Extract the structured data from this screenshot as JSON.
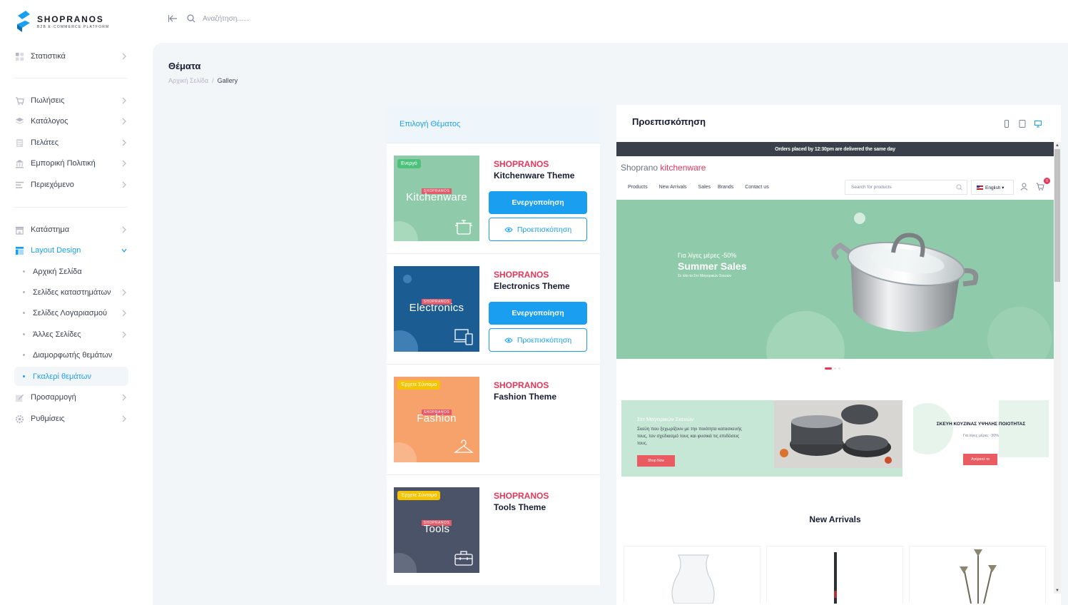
{
  "brand": {
    "name": "SHOPRANOS",
    "tagline": "B2B E-COMMERCE PLATFORM"
  },
  "topbar": {
    "search_placeholder": "Αναζήτηση......"
  },
  "sidebar": {
    "items": [
      {
        "label": "Στατιστικά",
        "icon": "dashboard-icon"
      },
      {
        "label": "Πωλήσεις",
        "icon": "cart-icon"
      },
      {
        "label": "Κατάλογος",
        "icon": "layers-icon"
      },
      {
        "label": "Πελάτες",
        "icon": "users-list-icon"
      },
      {
        "label": "Εμπορική Πολιτική",
        "icon": "bank-icon"
      },
      {
        "label": "Περιεχόμενο",
        "icon": "text-align-icon"
      },
      {
        "label": "Κατάστημα",
        "icon": "store-icon"
      },
      {
        "label": "Layout Design",
        "icon": "layout-icon"
      },
      {
        "label": "Προσαρμογή",
        "icon": "edit-icon"
      },
      {
        "label": "Ρυθμίσεις",
        "icon": "gear-icon"
      }
    ],
    "layout_sub": [
      {
        "label": "Αρχική Σελίδα"
      },
      {
        "label": "Σελίδες καταστημάτων"
      },
      {
        "label": "Σελίδες Λογαριασμού"
      },
      {
        "label": "Άλλες Σελίδες"
      },
      {
        "label": "Διαμορφωτής θεμάτων"
      },
      {
        "label": "Γκαλερί θεμάτων"
      }
    ]
  },
  "page": {
    "title": "Θέματα",
    "breadcrumb": [
      "Αρχική Σελίδα",
      "/",
      "Gallery"
    ]
  },
  "themes_panel": {
    "header": "Επιλογή Θέματος",
    "activate_label": "Ενεργοποίηση",
    "preview_label": "Προεπισκόπηση",
    "themes": [
      {
        "brand": "SHOPRANOS",
        "name": "Kitchenware Theme",
        "thumb_label": "Kitchenware",
        "thumb_brand": "SHOPRANOS",
        "badge": "Ενεργό",
        "badge_color": "#4cc27a",
        "bg": "#8fcbab",
        "icon": "pot-icon"
      },
      {
        "brand": "SHOPRANOS",
        "name": "Electronics Theme",
        "thumb_label": "Electronics",
        "thumb_brand": "SHOPRANOS",
        "badge": "",
        "bg": "#1b5d92",
        "icon": "devices-icon"
      },
      {
        "brand": "SHOPRANOS",
        "name": "Fashion Theme",
        "thumb_label": "Fashion",
        "thumb_brand": "SHOPRANOS",
        "badge": "Έρχετε Σύντομα",
        "badge_color": "#f5c400",
        "bg": "#f7a16b",
        "icon": "hanger-icon"
      },
      {
        "brand": "SHOPRANOS",
        "name": "Tools Theme",
        "thumb_label": "Tools",
        "thumb_brand": "SHOPRANOS",
        "badge": "Έρχετε Σύντομα",
        "badge_color": "#f5c400",
        "bg": "#4a5367",
        "icon": "toolbox-icon"
      }
    ]
  },
  "preview": {
    "title": "Προεπισκόπηση",
    "devices": [
      "mobile-icon",
      "tablet-icon",
      "desktop-icon"
    ],
    "site": {
      "announcement": "Orders placed by 12:30pm are delivered the same day",
      "logo_a": "Shoprano",
      "logo_b": " kitchenware",
      "nav": [
        "Products",
        "New Arrivals",
        "Sales",
        "Brands",
        "Contact us"
      ],
      "search_placeholder": "Search for products",
      "language": "English ▾",
      "cart_count": "0",
      "hero": {
        "sub": "Για λίγες μέρες -50%",
        "title": "Summer Sales",
        "small": "Σε όλα τα Σετ Μαγειρικών Σκευών"
      },
      "promo1": {
        "title": "Σετ Μαγειρικών Σκευών",
        "text": "Σκεύη που ξεχωρίζουν με την ποιότητα κατασκευής τους, τον σχεδιασμό τους και φυσικά τις επιδόσεις τους.",
        "button": "Shop Now"
      },
      "promo2": {
        "title": "ΣΚΕΥΗ ΚΟΥΖΙΝΑΣ ΥΨΗΛΗΣ ΠΟΙΟΤΗΤΑΣ",
        "text": "Για λίγες μέρες -30%",
        "button": "Αγόρασέ τα"
      },
      "arrivals_title": "New Arrivals"
    }
  },
  "colors": {
    "accent": "#1a9ff0",
    "brand_red": "#e6375b",
    "content_bg": "#f3f6f9"
  }
}
